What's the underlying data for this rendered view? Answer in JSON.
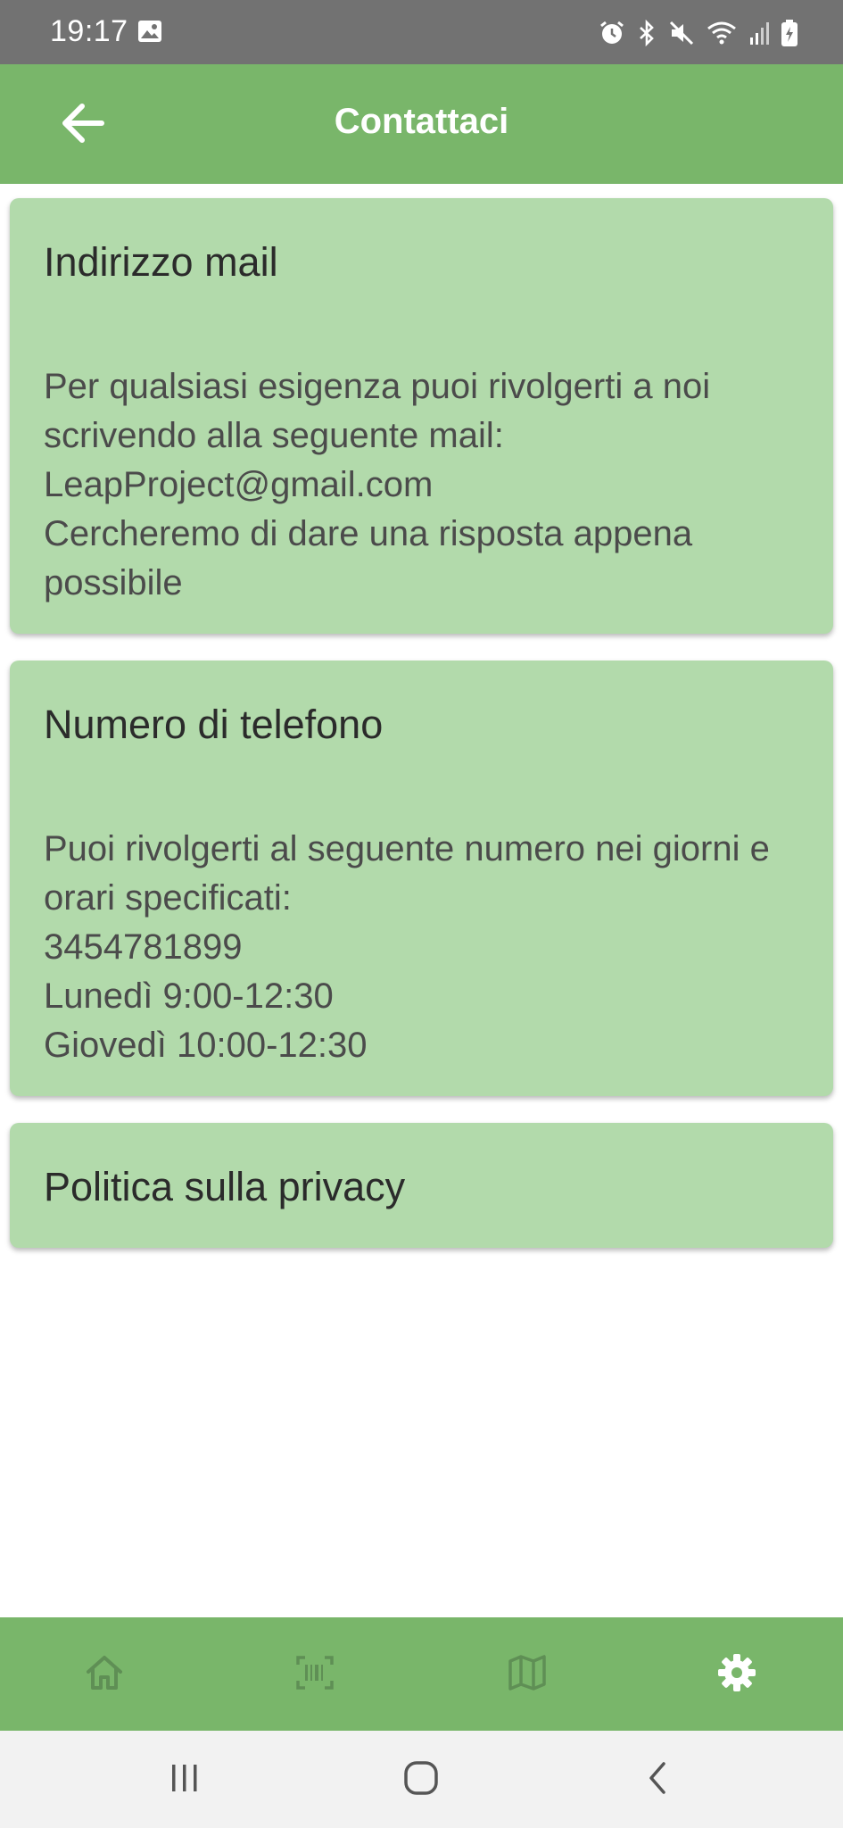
{
  "status_bar": {
    "time": "19:17",
    "icons": [
      "image-icon",
      "alarm-icon",
      "bluetooth-icon",
      "mute-icon",
      "wifi-icon",
      "signal-icon",
      "battery-icon"
    ]
  },
  "app_bar": {
    "title": "Contattaci",
    "back_icon": "arrow-left-icon"
  },
  "cards": {
    "mail": {
      "title": "Indirizzo mail",
      "body": "Per qualsiasi esigenza puoi rivolgerti a noi scrivendo alla seguente mail: LeapProject@gmail.com\nCercheremo di dare una risposta appena possibile"
    },
    "phone": {
      "title": "Numero di telefono",
      "body": "Puoi rivolgerti al seguente numero nei giorni e orari specificati:\n3454781899\nLunedì   9:00-12:30\nGiovedì  10:00-12:30"
    },
    "privacy": {
      "title": "Politica sulla privacy"
    }
  },
  "bottom_nav": {
    "items": [
      {
        "icon": "home-icon",
        "active": false
      },
      {
        "icon": "barcode-scan-icon",
        "active": false
      },
      {
        "icon": "map-icon",
        "active": false
      },
      {
        "icon": "gear-icon",
        "active": true
      }
    ]
  },
  "colors": {
    "primary": "#79b66a",
    "card": "#b2daab",
    "nav_inactive": "#5f8f55",
    "nav_active": "#ffffff"
  }
}
